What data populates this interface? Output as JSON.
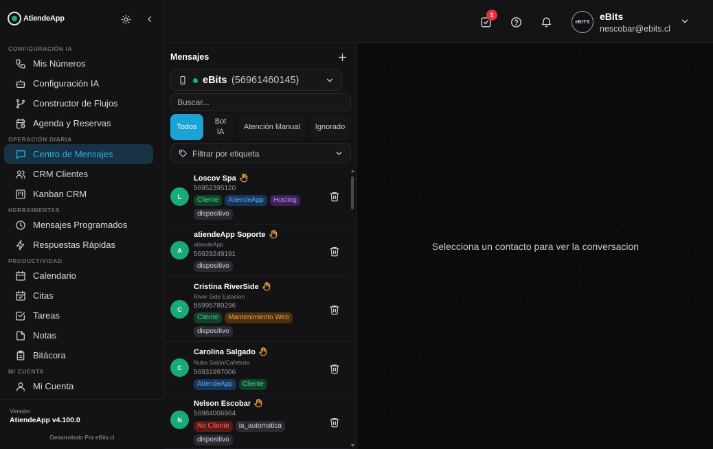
{
  "app": {
    "logo_text": "AtiendeApp",
    "accent": "#1ba3d6",
    "success": "#19b36b"
  },
  "sidebar": {
    "sections": [
      {
        "title": "CONFIGURACIÓN IA",
        "items": [
          {
            "label": "Mis Números",
            "icon": "phone-icon"
          },
          {
            "label": "Configuración IA",
            "icon": "robot-icon"
          },
          {
            "label": "Constructor de Flujos",
            "icon": "flow-icon"
          },
          {
            "label": "Agenda y Reservas",
            "icon": "calendar-clock-icon"
          }
        ]
      },
      {
        "title": "OPERACIÓN DIARIA",
        "items": [
          {
            "label": "Centro de Mensajes",
            "icon": "message-icon",
            "active": true
          },
          {
            "label": "CRM Clientes",
            "icon": "users-icon"
          },
          {
            "label": "Kanban CRM",
            "icon": "kanban-icon"
          }
        ]
      },
      {
        "title": "HERRAMIENTAS",
        "items": [
          {
            "label": "Mensajes Programados",
            "icon": "clock-icon"
          },
          {
            "label": "Respuestas Rápidas",
            "icon": "zap-icon"
          }
        ]
      },
      {
        "title": "PRODUCTIVIDAD",
        "items": [
          {
            "label": "Calendario",
            "icon": "calendar-icon"
          },
          {
            "label": "Citas",
            "icon": "calendar-check-icon"
          },
          {
            "label": "Tareas",
            "icon": "checkbox-icon"
          },
          {
            "label": "Notas",
            "icon": "file-icon"
          },
          {
            "label": "Bitácora",
            "icon": "clipboard-icon"
          }
        ]
      },
      {
        "title": "MI CUENTA",
        "items": [
          {
            "label": "Mi Cuenta",
            "icon": "user-icon"
          }
        ]
      }
    ],
    "version_label": "Versión",
    "version_value": "AtiendeApp v4.100.0",
    "developed_by": "Desarrollado Por eBits.cl"
  },
  "header": {
    "tasks_badge": "1",
    "user_name": "eBits",
    "user_email": "nescobar@ebits.cl",
    "avatar_text": "eBITS"
  },
  "messages": {
    "title": "Mensajes",
    "account_name": "eBits",
    "account_number": "(56961460145)",
    "search_placeholder": "Buscar...",
    "tabs": [
      {
        "label": "Todos",
        "active": true
      },
      {
        "label": "Bot IA"
      },
      {
        "label": "Atención Manual"
      },
      {
        "label": "Ignorado"
      }
    ],
    "filter_label": "Filtrar por etiqueta",
    "contacts": [
      {
        "initial": "L",
        "name": "Loscov Spa",
        "subtitle": "",
        "phone": "56952395120",
        "tags": [
          {
            "label": "Cliente",
            "kind": "green"
          },
          {
            "label": "AtiendeApp",
            "kind": "blue"
          },
          {
            "label": "Hosting",
            "kind": "purple"
          },
          {
            "label": "dispositivo",
            "kind": "gray"
          }
        ]
      },
      {
        "initial": "A",
        "name": "atiendeApp Soporte",
        "subtitle": "atiendeApp",
        "phone": "56929249191",
        "tags": [
          {
            "label": "dispositivo",
            "kind": "gray"
          }
        ]
      },
      {
        "initial": "C",
        "name": "Cristina RiverSide",
        "subtitle": "River Side Estacion",
        "phone": "56995789296",
        "tags": [
          {
            "label": "Cliente",
            "kind": "green"
          },
          {
            "label": "Mantenimiento Web",
            "kind": "orange"
          },
          {
            "label": "dispositivo",
            "kind": "gray"
          }
        ]
      },
      {
        "initial": "C",
        "name": "Carolina Salgado",
        "subtitle": "Nuba Salón/Cafeteria",
        "phone": "56931997006",
        "tags": [
          {
            "label": "AtiendeApp",
            "kind": "blue"
          },
          {
            "label": "Cliente",
            "kind": "green"
          }
        ]
      },
      {
        "initial": "N",
        "name": "Nelson Escobar",
        "subtitle": "",
        "phone": "56984006964",
        "tags": [
          {
            "label": "No Cliente",
            "kind": "red"
          },
          {
            "label": "ia_automatica",
            "kind": "gray"
          },
          {
            "label": "dispositivo",
            "kind": "gray"
          }
        ]
      }
    ]
  },
  "chat": {
    "empty_text": "Selecciona un contacto para ver la conversacion"
  },
  "tag_colors": {
    "green": {
      "bg": "#12402a",
      "fg": "#3ddc84"
    },
    "blue": {
      "bg": "#173657",
      "fg": "#5aa7f2"
    },
    "purple": {
      "bg": "#3d2258",
      "fg": "#c586f5"
    },
    "orange": {
      "bg": "#4a300e",
      "fg": "#f0a43c"
    },
    "red": {
      "bg": "#5a1a1a",
      "fg": "#ff6b5e"
    },
    "gray": {
      "bg": "#2a2a30",
      "fg": "#d5d5da"
    }
  }
}
